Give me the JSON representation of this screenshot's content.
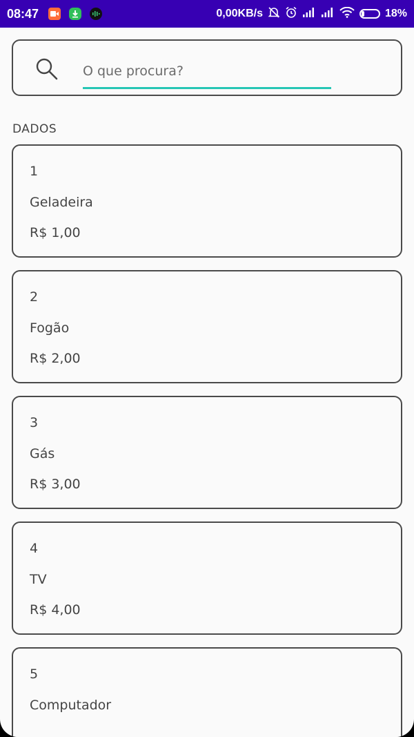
{
  "status_bar": {
    "time": "08:47",
    "network_speed": "0,00KB/s",
    "battery_percent_label": "18%",
    "battery_level": 0.18,
    "notification_icons": [
      "video-app-icon",
      "download-app-icon",
      "audio-app-icon"
    ],
    "system_icons": [
      "silent-bell-icon",
      "alarm-icon",
      "signal-icon",
      "signal-icon",
      "wifi-icon",
      "battery-icon"
    ]
  },
  "search": {
    "placeholder": "O que procura?",
    "value": ""
  },
  "section": {
    "title": "DADOS"
  },
  "items": [
    {
      "id": "1",
      "name": "Geladeira",
      "price": "R$ 1,00"
    },
    {
      "id": "2",
      "name": "Fogão",
      "price": "R$ 2,00"
    },
    {
      "id": "3",
      "name": "Gás",
      "price": "R$ 3,00"
    },
    {
      "id": "4",
      "name": "TV",
      "price": "R$ 4,00"
    },
    {
      "id": "5",
      "name": "Computador",
      "price": ""
    }
  ],
  "colors": {
    "status_bar": "#3700b3",
    "accent_underline": "#26c6b5",
    "background": "#fafafa",
    "border": "#4a4a4a"
  }
}
